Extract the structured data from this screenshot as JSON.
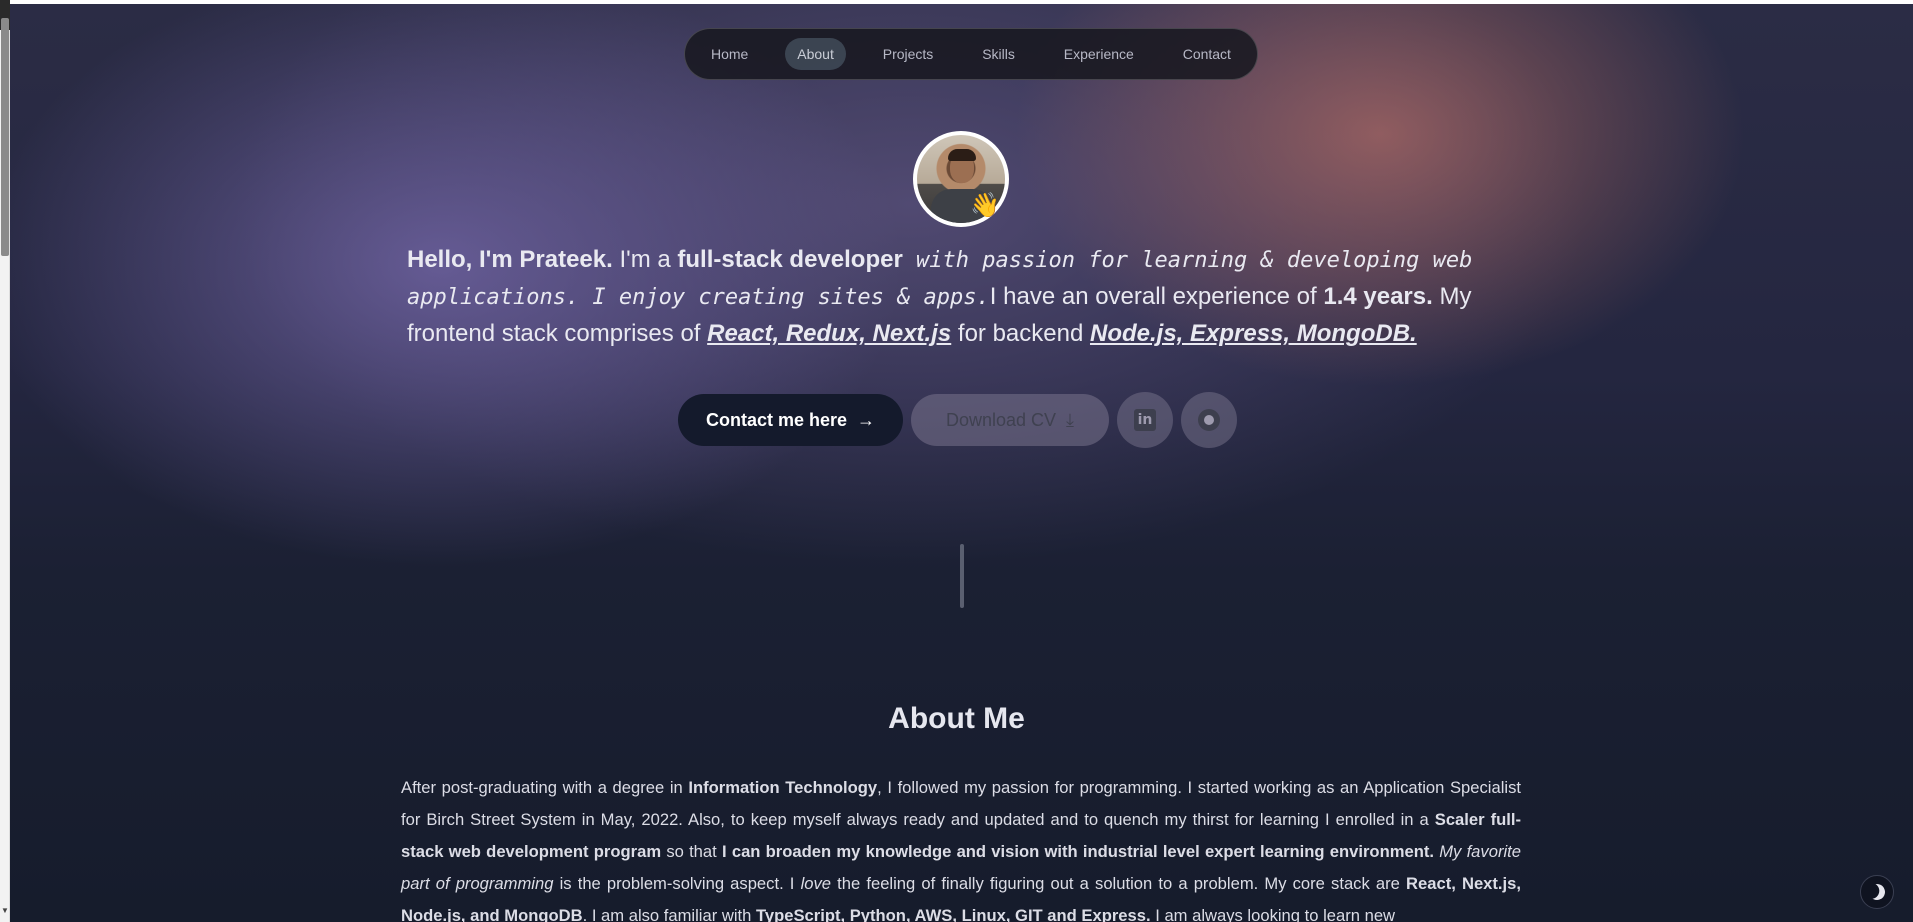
{
  "nav": {
    "items": [
      {
        "label": "Home"
      },
      {
        "label": "About"
      },
      {
        "label": "Projects"
      },
      {
        "label": "Skills"
      },
      {
        "label": "Experience"
      },
      {
        "label": "Contact"
      }
    ],
    "active": "About"
  },
  "hero": {
    "wave_emoji": "👋",
    "intro": {
      "p1": "Hello, I'm Prateek.",
      "p2": " I'm a ",
      "p3": "full-stack developer",
      "p4": " with passion for learning & developing web applications. I enjoy creating sites & apps.",
      "p5": "I have an overall experience of ",
      "p6": "1.4 years.",
      "p7": " My frontend stack comprises of ",
      "p8": "React, Redux, Next.js",
      "p9": " for backend ",
      "p10": "Node.js, Express, MongoDB."
    },
    "buttons": {
      "contact": "Contact me here",
      "contact_icon": "→",
      "cv": "Download CV",
      "cv_icon": "⤓",
      "linkedin_icon": "in"
    }
  },
  "about": {
    "title": "About Me",
    "t1": "After post-graduating with a degree in ",
    "t2": "Information Technology",
    "t3": ", I followed my passion for programming. I started working as an Application Specialist for Birch Street System in May, 2022. Also, to keep myself always ready and updated and to quench my thirst for learning I enrolled in a ",
    "t4": "Scaler full-stack web development program",
    "t5": " so that ",
    "t6": "I can broaden my knowledge and vision with industrial level expert learning environment.",
    "t7": " ",
    "t8": "My favorite part of programming",
    "t9": " is the problem-solving aspect. I ",
    "t10": "love",
    "t11": " the feeling of finally figuring out a solution to a problem. My core stack are ",
    "t12": "React, Next.js, Node.js, and MongoDB",
    "t13": ". I am also familiar with ",
    "t14": "TypeScript, Python, AWS, Linux, GIT and Express.",
    "t15": " I am always looking to learn new"
  },
  "colors": {
    "contact_button": "#141a2c",
    "background": "#151b2b",
    "gradient_purple": "#6e62a0",
    "gradient_rose": "#aa6864"
  }
}
